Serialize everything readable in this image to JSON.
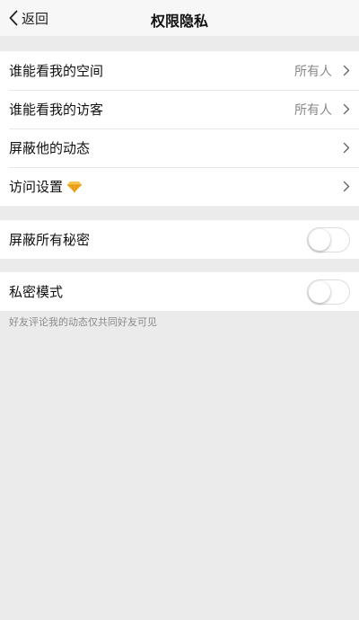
{
  "header": {
    "back_label": "返回",
    "title": "权限隐私"
  },
  "groups": [
    {
      "rows": [
        {
          "label": "谁能看我的空间",
          "value": "所有人"
        },
        {
          "label": "谁能看我的访客",
          "value": "所有人"
        },
        {
          "label": "屏蔽他的动态"
        },
        {
          "label": "访问设置",
          "icon": "diamond-icon"
        }
      ]
    },
    {
      "rows": [
        {
          "label": "屏蔽所有秘密",
          "toggle": false
        }
      ]
    },
    {
      "rows": [
        {
          "label": "私密模式",
          "toggle": false
        }
      ]
    }
  ],
  "footnote": "好友评论我的动态仅共同好友可见",
  "colors": {
    "background": "#ebebeb",
    "navbar": "#f7f7f7",
    "diamond": "#f2a81c"
  }
}
